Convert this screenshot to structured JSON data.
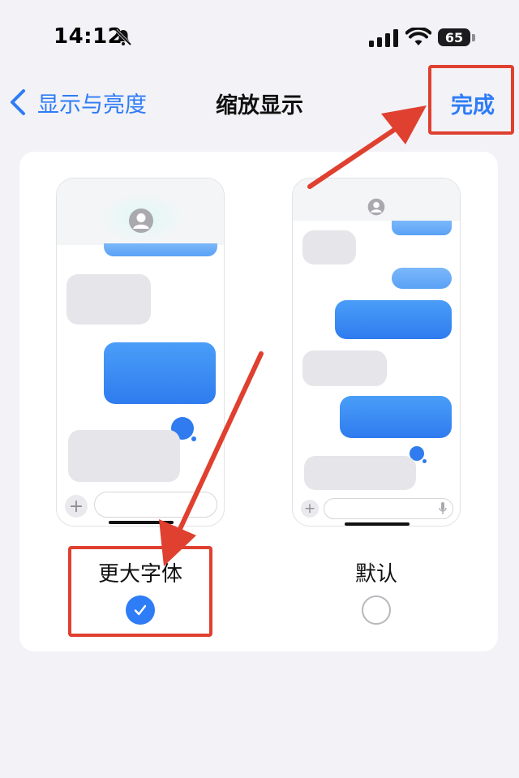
{
  "status_bar": {
    "time": "14:12",
    "battery": "65"
  },
  "nav": {
    "back_label": "显示与亮度",
    "title": "缩放显示",
    "done_label": "完成"
  },
  "options": [
    {
      "label": "更大字体",
      "selected": true
    },
    {
      "label": "默认",
      "selected": false
    }
  ],
  "colors": {
    "accent": "#2e7cf6",
    "annotation": "#e0402f",
    "background": "#f2f2f7"
  }
}
